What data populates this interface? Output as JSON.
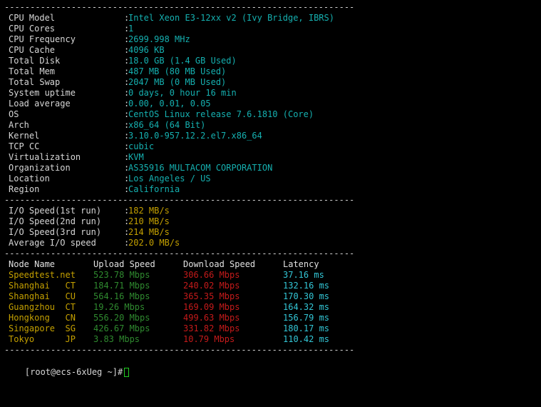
{
  "separator": "------------------------------------------------------------------------------------",
  "system_info": [
    {
      "key": "CPU Model",
      "value": "Intel Xeon E3-12xx v2 (Ivy Bridge, IBRS)"
    },
    {
      "key": "CPU Cores",
      "value": "1"
    },
    {
      "key": "CPU Frequency",
      "value": "2699.998 MHz"
    },
    {
      "key": "CPU Cache",
      "value": "4096 KB"
    },
    {
      "key": "Total Disk",
      "value": "18.0 GB (1.4 GB Used)"
    },
    {
      "key": "Total Mem",
      "value": "487 MB (80 MB Used)"
    },
    {
      "key": "Total Swap",
      "value": "2047 MB (0 MB Used)"
    },
    {
      "key": "System uptime",
      "value": "0 days, 0 hour 16 min"
    },
    {
      "key": "Load average",
      "value": "0.00, 0.01, 0.05"
    },
    {
      "key": "OS",
      "value": "CentOS Linux release 7.6.1810 (Core)"
    },
    {
      "key": "Arch",
      "value": "x86_64 (64 Bit)"
    },
    {
      "key": "Kernel",
      "value": "3.10.0-957.12.2.el7.x86_64"
    },
    {
      "key": "TCP CC",
      "value": "cubic"
    },
    {
      "key": "Virtualization",
      "value": "KVM"
    },
    {
      "key": "Organization",
      "value": "AS35916 MULTACOM CORPORATION"
    },
    {
      "key": "Location",
      "value": "Los Angeles / US"
    },
    {
      "key": "Region",
      "value": "California"
    }
  ],
  "io_info": [
    {
      "key": "I/O Speed(1st run)",
      "value": "182 MB/s"
    },
    {
      "key": "I/O Speed(2nd run)",
      "value": "210 MB/s"
    },
    {
      "key": "I/O Speed(3rd run)",
      "value": "214 MB/s"
    },
    {
      "key": "Average I/O speed",
      "value": "202.0 MB/s"
    }
  ],
  "speedtest": {
    "headers": {
      "node": "Node Name",
      "upload": "Upload Speed",
      "download": "Download Speed",
      "latency": "Latency"
    },
    "rows": [
      {
        "node": "Speedtest.net",
        "upload": "523.78 Mbps",
        "download": "306.66 Mbps",
        "latency": "37.16 ms"
      },
      {
        "node": "Shanghai   CT",
        "upload": "184.71 Mbps",
        "download": "240.02 Mbps",
        "latency": "132.16 ms"
      },
      {
        "node": "Shanghai   CU",
        "upload": "564.16 Mbps",
        "download": "365.35 Mbps",
        "latency": "170.30 ms"
      },
      {
        "node": "Guangzhou  CT",
        "upload": "19.26 Mbps",
        "download": "169.09 Mbps",
        "latency": "164.32 ms"
      },
      {
        "node": "Hongkong   CN",
        "upload": "556.20 Mbps",
        "download": "499.63 Mbps",
        "latency": "156.79 ms"
      },
      {
        "node": "Singapore  SG",
        "upload": "426.67 Mbps",
        "download": "331.82 Mbps",
        "latency": "180.17 ms"
      },
      {
        "node": "Tokyo      JP",
        "upload": "3.83 Mbps",
        "download": "10.79 Mbps",
        "latency": "110.42 ms"
      }
    ]
  },
  "prompt": "[root@ecs-6xUeg ~]#",
  "colors": {
    "background": "#000000",
    "label": "#d6d6d6",
    "system_value": "#15b0b0",
    "io_value": "#c4a000",
    "node": "#c4a000",
    "upload": "#2f8a2f",
    "download": "#c41a1a",
    "latency": "#33c6d6",
    "cursor": "#22cc22"
  }
}
